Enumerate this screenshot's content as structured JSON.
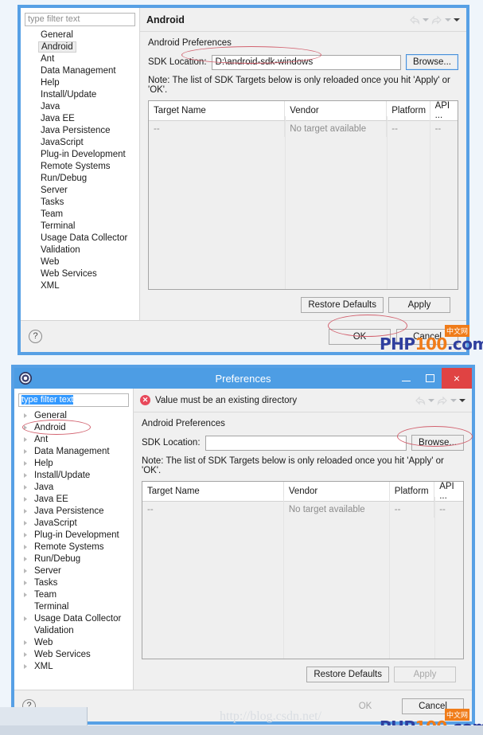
{
  "app": {
    "window_title": "Preferences",
    "title_icon": "eclipse-gear-icon"
  },
  "window_controls": {
    "minimize": "minimize-icon",
    "maximize": "maximize-icon",
    "close": "×"
  },
  "sidebar": {
    "filter_placeholder": "type filter text",
    "filter_value": "type filter text",
    "items": [
      "General",
      "Android",
      "Ant",
      "Data Management",
      "Help",
      "Install/Update",
      "Java",
      "Java EE",
      "Java Persistence",
      "JavaScript",
      "Plug-in Development",
      "Remote Systems",
      "Run/Debug",
      "Server",
      "Tasks",
      "Team",
      "Terminal",
      "Usage Data Collector",
      "Validation",
      "Web",
      "Web Services",
      "XML"
    ],
    "selected": "Android",
    "leaf_items": [
      "Terminal",
      "Validation"
    ]
  },
  "dialog_top": {
    "pane_title": "Android",
    "section_title": "Android Preferences",
    "sdk_label": "SDK Location:",
    "sdk_value": "D:\\android-sdk-windows",
    "sdk_placeholder": "",
    "browse_label": "Browse...",
    "note": "Note: The list of SDK Targets below is only reloaded once you hit 'Apply' or 'OK'.",
    "restore_label": "Restore Defaults",
    "apply_label": "Apply",
    "ok_label": "OK",
    "cancel_label": "Cancel",
    "help_label": "?"
  },
  "dialog_bottom": {
    "error_message": "Value must be an existing directory",
    "error_icon": "error-circle-icon",
    "section_title": "Android Preferences",
    "sdk_label": "SDK Location:",
    "sdk_value": "",
    "browse_label": "Browse...",
    "note": "Note: The list of SDK Targets below is only reloaded once you hit 'Apply' or 'OK'.",
    "restore_label": "Restore Defaults",
    "apply_label": "Apply",
    "ok_label": "OK",
    "cancel_label": "Cancel",
    "help_label": "?"
  },
  "table": {
    "columns": [
      "Target Name",
      "Vendor",
      "Platform",
      "API ..."
    ],
    "rows": [
      [
        "--",
        "No target available",
        "--",
        "--"
      ]
    ]
  },
  "toolbar": {
    "back_icon": "back-arrow-icon",
    "back_menu_icon": "chevron-down-icon",
    "forward_icon": "forward-arrow-icon",
    "forward_menu_icon": "chevron-down-icon",
    "view_menu_icon": "chevron-down-icon"
  },
  "watermarks": {
    "php_blue": "PHP",
    "php_orange": "100",
    "php_suffix": ".com",
    "chinese_badge": "中文网",
    "url": "http://blog.csdn.net/"
  },
  "colors": {
    "title_bar": "#4d9de4",
    "dialog_border": "#57a0e5",
    "close_button": "#e04343",
    "error_red": "#e8485a",
    "annotation_red": "#d2626f",
    "page_background": "#eff5fb",
    "watermark_blue": "#2f3f9e",
    "watermark_orange": "#f07c19"
  }
}
